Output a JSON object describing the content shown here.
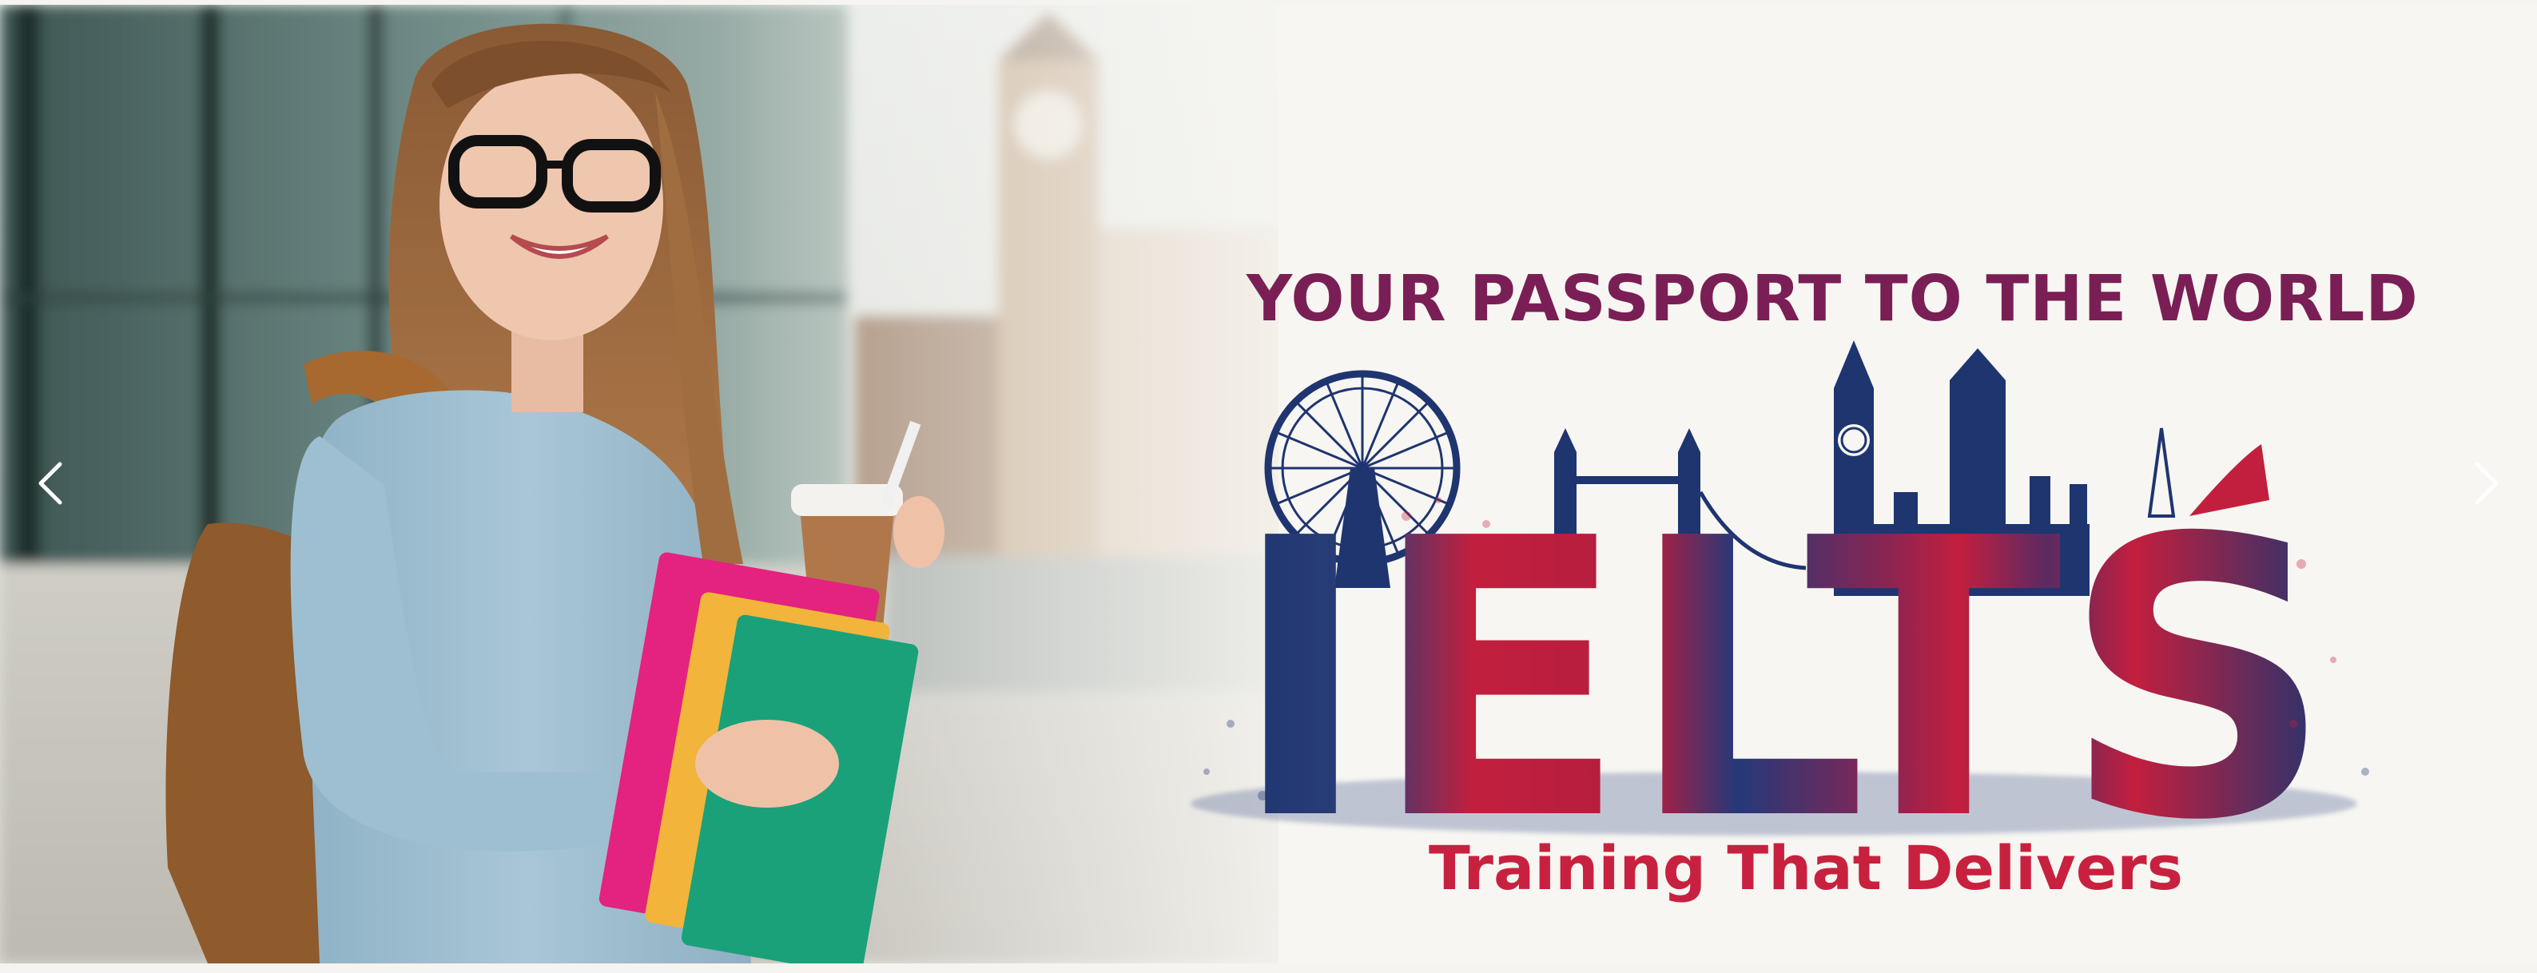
{
  "banner": {
    "headline": "YOUR PASSPORT TO THE WORLD",
    "logo_text": "IELTS",
    "tagline": "Training That  Delivers"
  },
  "controls": {
    "prev_icon": "chevron-left-icon",
    "next_icon": "chevron-right-icon"
  },
  "colors": {
    "headline": "#7a1f55",
    "tagline": "#c8213f",
    "ielts_navy": "#1f3570",
    "ielts_red": "#c21f3e",
    "background": "#f6f4f0"
  }
}
